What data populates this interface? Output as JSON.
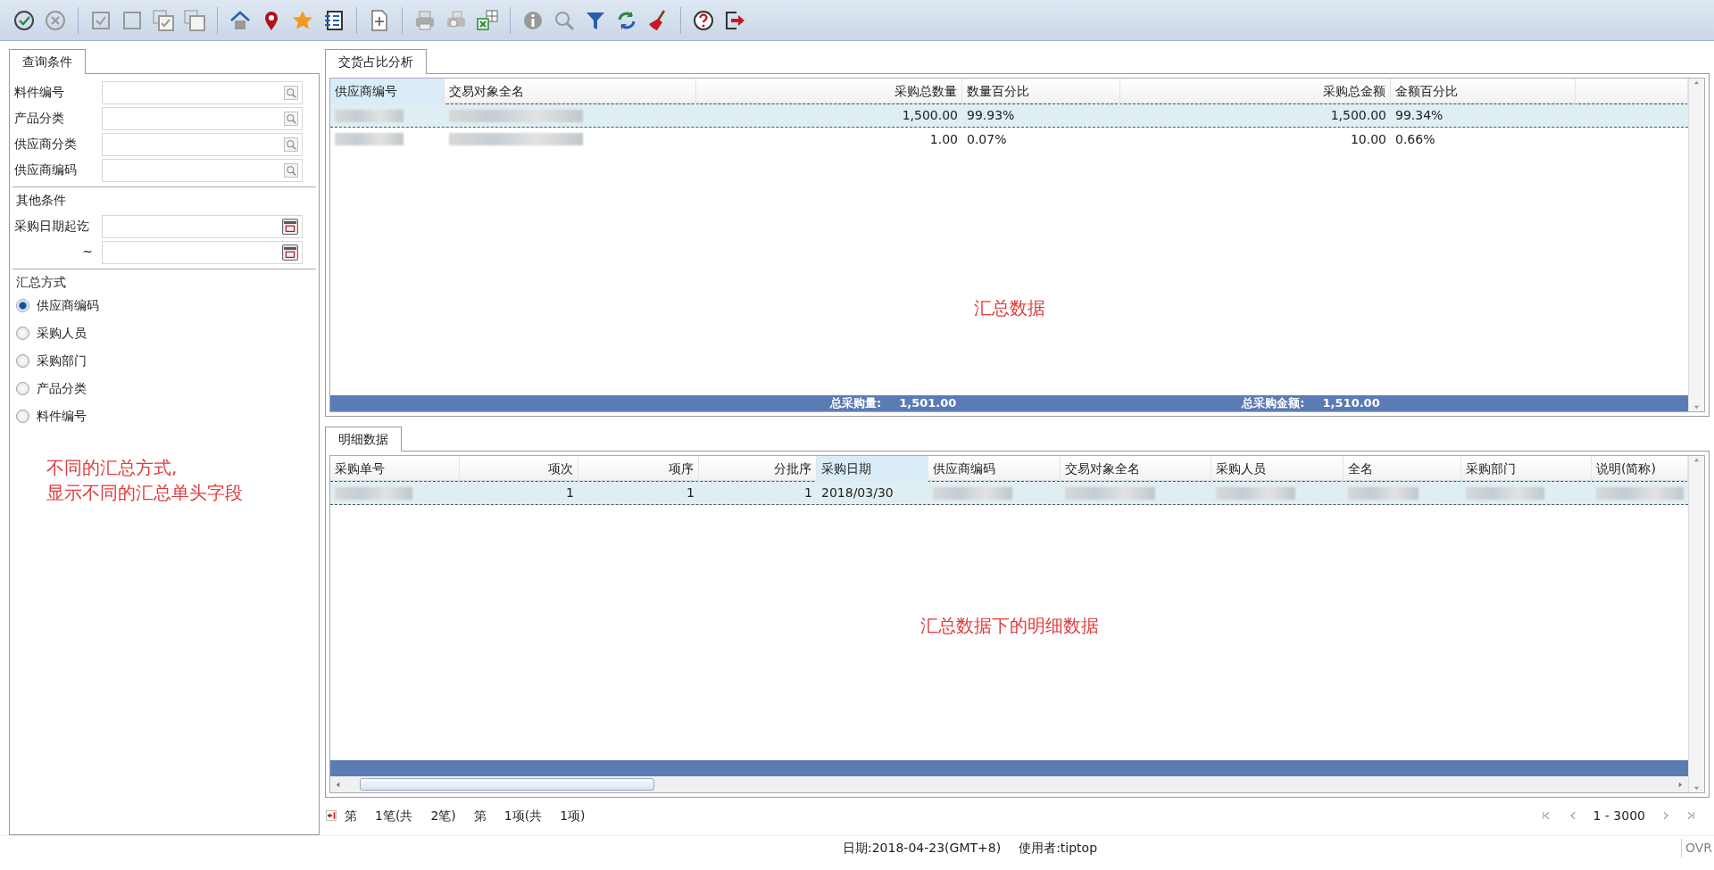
{
  "query_panel": {
    "tab": {
      "label": "查询条件",
      "selected": true
    },
    "fields": [
      {
        "label": "料件编号",
        "kind": "lookup"
      },
      {
        "label": "产品分类",
        "kind": "lookup"
      },
      {
        "label": "供应商分类",
        "kind": "lookup"
      },
      {
        "label": "供应商编码",
        "kind": "lookup"
      }
    ],
    "other_heading": "其他条件",
    "date_fields": [
      {
        "label": "采购日期起讫",
        "kind": "date"
      },
      {
        "label": "~",
        "kind": "date"
      }
    ],
    "summary_heading": "汇总方式",
    "summary_options": [
      {
        "label": "供应商编码",
        "selected": true
      },
      {
        "label": "采购人员",
        "selected": false
      },
      {
        "label": "采购部门",
        "selected": false
      },
      {
        "label": "产品分类",
        "selected": false
      },
      {
        "label": "料件编号",
        "selected": false
      }
    ],
    "note_lines": [
      "不同的汇总方式,",
      "显示不同的汇总单头字段"
    ]
  },
  "summary_section": {
    "tab": {
      "label": "交货占比分析",
      "selected": true
    },
    "columns": [
      {
        "label": "供应商编号",
        "sorted": true
      },
      {
        "label": "交易对象全名",
        "sorted": false
      },
      {
        "label": "采购总数量",
        "sorted": false
      },
      {
        "label": "数量百分比",
        "sorted": false
      },
      {
        "label": "采购总金额",
        "sorted": false
      },
      {
        "label": "金额百分比",
        "sorted": false
      }
    ],
    "rows": [
      {
        "selected": true,
        "cells": [
          {
            "kind": "blurred"
          },
          {
            "kind": "blurred"
          },
          {
            "kind": "text",
            "text": "1,500.00"
          },
          {
            "kind": "text",
            "text": "99.93%"
          },
          {
            "kind": "text",
            "text": "1,500.00"
          },
          {
            "kind": "text",
            "text": "99.34%"
          }
        ]
      },
      {
        "selected": false,
        "cells": [
          {
            "kind": "blurred"
          },
          {
            "kind": "blurred"
          },
          {
            "kind": "text",
            "text": "1.00"
          },
          {
            "kind": "text",
            "text": "0.07%"
          },
          {
            "kind": "text",
            "text": "10.00"
          },
          {
            "kind": "text",
            "text": "0.66%"
          }
        ]
      }
    ],
    "annotation": "汇总数据",
    "totals": [
      {
        "label": "总采购量:",
        "value": "1,501.00"
      },
      {
        "label": "总采购金额:",
        "value": "1,510.00"
      }
    ]
  },
  "detail_section": {
    "tab": {
      "label": "明细数据",
      "selected": true
    },
    "columns": [
      {
        "label": "采购单号",
        "sorted": false
      },
      {
        "label": "项次",
        "sorted": false
      },
      {
        "label": "项序",
        "sorted": false
      },
      {
        "label": "分批序",
        "sorted": false
      },
      {
        "label": "采购日期",
        "sorted": true
      },
      {
        "label": "供应商编码",
        "sorted": false
      },
      {
        "label": "交易对象全名",
        "sorted": false
      },
      {
        "label": "采购人员",
        "sorted": false
      },
      {
        "label": "全名",
        "sorted": false
      },
      {
        "label": "采购部门",
        "sorted": false
      },
      {
        "label": "说明(简称)",
        "sorted": false
      }
    ],
    "rows": [
      {
        "selected": true,
        "cells": [
          {
            "kind": "blurred"
          },
          {
            "kind": "text",
            "text": "1"
          },
          {
            "kind": "text",
            "text": "1"
          },
          {
            "kind": "text",
            "text": "1"
          },
          {
            "kind": "text",
            "text": "2018/03/30"
          },
          {
            "kind": "blurred"
          },
          {
            "kind": "blurred"
          },
          {
            "kind": "blurred"
          },
          {
            "kind": "blurred"
          },
          {
            "kind": "blurred"
          },
          {
            "kind": "blurred"
          }
        ]
      }
    ],
    "annotation": "汇总数据下的明细数据"
  },
  "pager": {
    "parts": [
      "第",
      "1笔(共",
      "2笔)",
      "第",
      "1项(共",
      "1项)"
    ],
    "range": "1 - 3000"
  },
  "status_bar": {
    "date": "日期:2018-04-23(GMT+8)",
    "user": "使用者:tiptop",
    "mode": "OVR"
  }
}
